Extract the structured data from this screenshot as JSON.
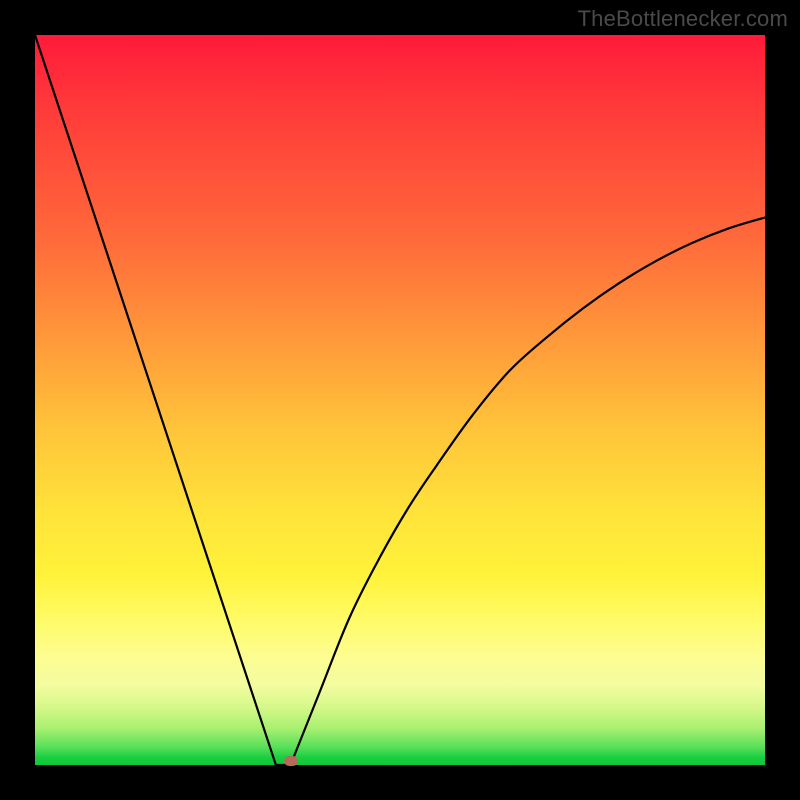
{
  "watermark": "TheBottlenecker.com",
  "colors": {
    "curve": "#000000",
    "marker": "#b56a5a",
    "frame": "#000000"
  },
  "chart_data": {
    "type": "line",
    "title": "",
    "xlabel": "",
    "ylabel": "",
    "xlim": [
      0,
      100
    ],
    "ylim": [
      0,
      100
    ],
    "series": [
      {
        "name": "left-branch",
        "x": [
          0.0,
          3.3,
          6.6,
          9.9,
          13.2,
          16.5,
          19.8,
          23.1,
          26.4,
          29.7,
          33.0
        ],
        "values": [
          100.0,
          90.0,
          80.0,
          70.0,
          60.0,
          50.0,
          40.0,
          30.0,
          20.0,
          10.0,
          0.0
        ]
      },
      {
        "name": "right-branch",
        "x": [
          35.0,
          39.0,
          43.0,
          47.0,
          51.0,
          55.0,
          60.0,
          65.0,
          70.0,
          75.0,
          80.0,
          85.0,
          90.0,
          95.0,
          100.0
        ],
        "values": [
          0.0,
          10.0,
          20.0,
          28.0,
          35.0,
          41.0,
          48.0,
          54.0,
          58.5,
          62.5,
          66.0,
          69.0,
          71.5,
          73.5,
          75.0
        ]
      }
    ],
    "marker": {
      "x": 35.0,
      "y": 0.6
    },
    "gradient_stops": [
      {
        "pos": 0,
        "color": "#ff1a3a"
      },
      {
        "pos": 42,
        "color": "#ff9a3a"
      },
      {
        "pos": 74,
        "color": "#fff23a"
      },
      {
        "pos": 100,
        "color": "#10c838"
      }
    ]
  }
}
